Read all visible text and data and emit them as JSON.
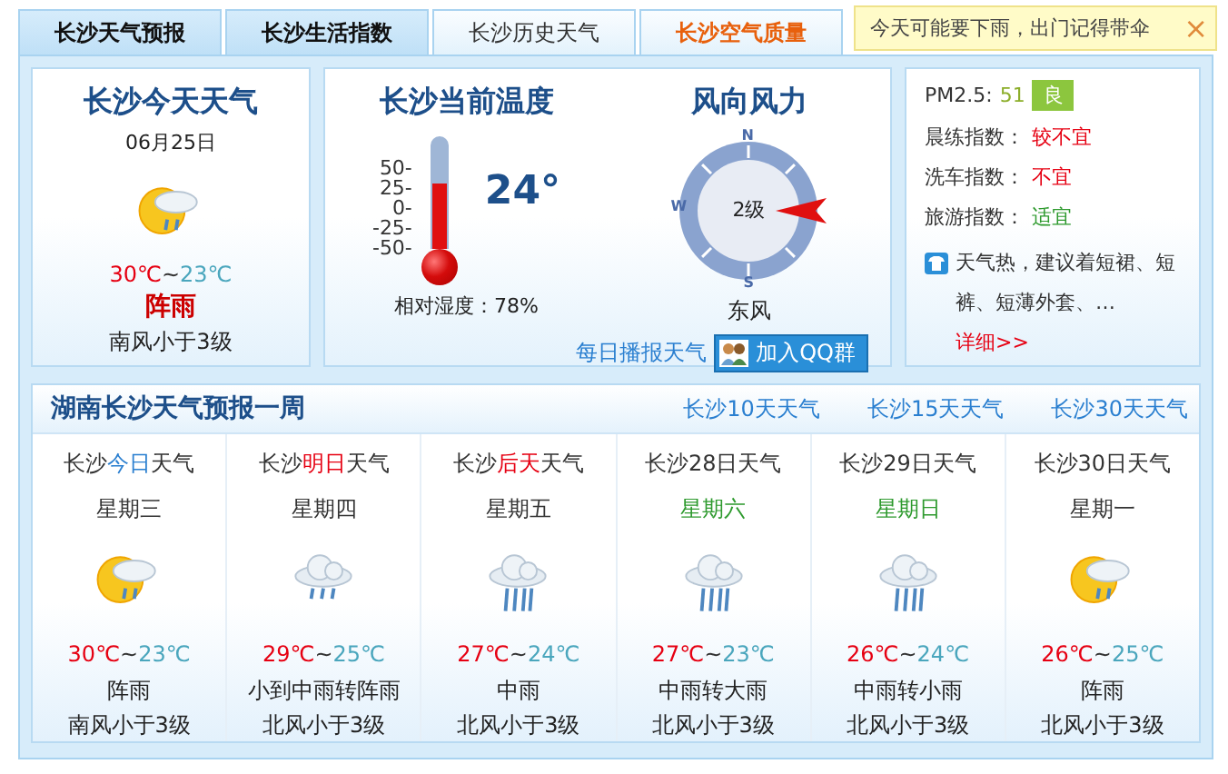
{
  "tabs": [
    {
      "label": "长沙天气预报",
      "selected": true
    },
    {
      "label": "长沙生活指数",
      "selected": true
    },
    {
      "label": "长沙历史天气",
      "selected": false
    },
    {
      "label": "长沙空气质量",
      "selected": false,
      "color": "#e8600c"
    }
  ],
  "notice": {
    "text": "今天可能要下雨，出门记得带伞",
    "close": "×"
  },
  "today": {
    "title": "长沙今天天气",
    "date": "06月25日",
    "kind": "sun-rain",
    "high": "30℃",
    "separator": "~",
    "low": "23℃",
    "condition": "阵雨",
    "wind": "南风小于3级"
  },
  "current": {
    "title": "长沙当前温度",
    "scale": [
      "50-",
      "25-",
      "0-",
      "-25-",
      "-50-"
    ],
    "level": 0.58,
    "temperature": "24°",
    "humidity": "相对湿度：78%"
  },
  "wind": {
    "title": "风向风力",
    "directions": [
      "N",
      "W",
      "S"
    ],
    "force": "2级",
    "direction": "东风",
    "broadcast_link": "每日播报天气",
    "qq_button": "加入QQ群"
  },
  "indices": {
    "pm_label": "PM2.5:",
    "pm_value": "51",
    "pm_badge": "良",
    "items": [
      {
        "label": "晨练指数：",
        "value": "较不宜",
        "color": "#e60012"
      },
      {
        "label": "洗车指数：",
        "value": "不宜",
        "color": "#e60012"
      },
      {
        "label": "旅游指数：",
        "value": "适宜",
        "color": "#2e9a2e"
      }
    ],
    "tip": "天气热，建议着短裙、短裤、短薄外套、…",
    "tip_link": "详细>>"
  },
  "week": {
    "title": "湖南长沙天气预报一周",
    "links": [
      "长沙10天天气",
      "长沙15天天气",
      "长沙30天天气"
    ],
    "days": [
      {
        "title": [
          {
            "text": "长沙"
          },
          {
            "text": "今日",
            "color": "#2a7fd0"
          },
          {
            "text": "天气"
          }
        ],
        "weekday": "星期三",
        "weekend": false,
        "kind": "sun-rain",
        "high": "30℃",
        "separator": "~",
        "low": "23℃",
        "condition": "阵雨",
        "wind": "南风小于3级"
      },
      {
        "title": [
          {
            "text": "长沙"
          },
          {
            "text": "明日",
            "color": "#e60012"
          },
          {
            "text": "天气"
          }
        ],
        "weekday": "星期四",
        "weekend": false,
        "kind": "cloud-rain",
        "high": "29℃",
        "separator": "~",
        "low": "25℃",
        "condition": "小到中雨转阵雨",
        "wind": "北风小于3级"
      },
      {
        "title": [
          {
            "text": "长沙"
          },
          {
            "text": "后天",
            "color": "#e60012"
          },
          {
            "text": "天气"
          }
        ],
        "weekday": "星期五",
        "weekend": false,
        "kind": "heavy-rain",
        "high": "27℃",
        "separator": "~",
        "low": "24℃",
        "condition": "中雨",
        "wind": "北风小于3级"
      },
      {
        "title": [
          {
            "text": "长沙28日天气"
          }
        ],
        "weekday": "星期六",
        "weekend": true,
        "kind": "heavy-rain",
        "high": "27℃",
        "separator": "~",
        "low": "23℃",
        "condition": "中雨转大雨",
        "wind": "北风小于3级"
      },
      {
        "title": [
          {
            "text": "长沙29日天气"
          }
        ],
        "weekday": "星期日",
        "weekend": true,
        "kind": "heavy-rain",
        "high": "26℃",
        "separator": "~",
        "low": "24℃",
        "condition": "中雨转小雨",
        "wind": "北风小于3级"
      },
      {
        "title": [
          {
            "text": "长沙30日天气"
          }
        ],
        "weekday": "星期一",
        "weekend": false,
        "kind": "sun-rain",
        "high": "26℃",
        "separator": "~",
        "low": "25℃",
        "condition": "阵雨",
        "wind": "北风小于3级"
      }
    ]
  }
}
